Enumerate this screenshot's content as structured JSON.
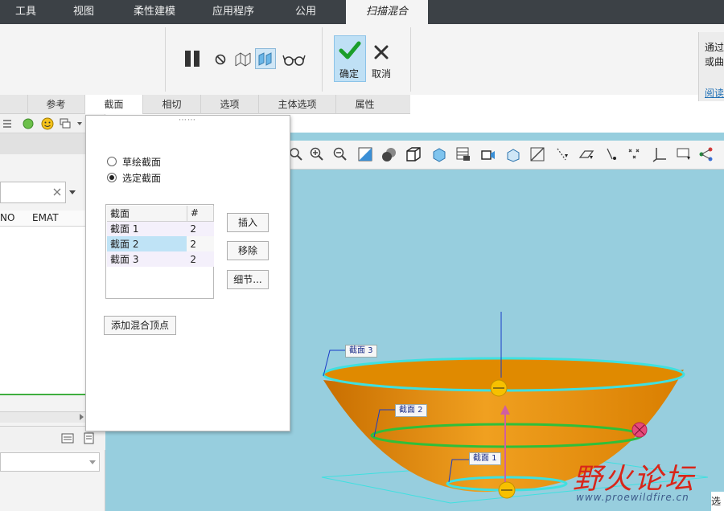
{
  "top_tabs": [
    {
      "label": "工具"
    },
    {
      "label": "视图"
    },
    {
      "label": "柔性建模"
    },
    {
      "label": "应用程序"
    },
    {
      "label": "公用"
    },
    {
      "label": "扫描混合"
    }
  ],
  "ribbon": {
    "ok_label": "确定",
    "cancel_label": "取消",
    "hint_line1": "通过",
    "hint_line2": "或曲",
    "read_link": "阅读"
  },
  "dashboard_tabs": [
    {
      "label": "参考"
    },
    {
      "label": "截面"
    },
    {
      "label": "相切"
    },
    {
      "label": "选项"
    },
    {
      "label": "主体选项"
    },
    {
      "label": "属性"
    }
  ],
  "left_panel": {
    "col1": "NO",
    "col2": "EMAT"
  },
  "section_panel": {
    "grip": "⋯⋯",
    "radio_sketch": "草绘截面",
    "radio_select": "选定截面",
    "table_header_name": "截面",
    "table_header_count": "#",
    "rows": [
      {
        "name": "截面 1",
        "count": "2"
      },
      {
        "name": "截面 2",
        "count": "2"
      },
      {
        "name": "截面 3",
        "count": "2"
      }
    ],
    "insert_label": "插入",
    "remove_label": "移除",
    "details_label": "细节...",
    "add_vertex_label": "添加混合顶点"
  },
  "viewport": {
    "labels": [
      {
        "text": "截面 3"
      },
      {
        "text": "截面 2"
      },
      {
        "text": "截面 1"
      }
    ],
    "corner_text": "选"
  },
  "watermark": {
    "cn": "野火论坛",
    "url": "www.proewildfire.cn"
  },
  "colors": {
    "top_bar": "#3c4146",
    "viewport_bg": "#97cede",
    "model_orange": "#e08a00",
    "section_cyan": "#3fe0e0",
    "section_green": "#2fbf3a",
    "accent_check": "#1a9e2a"
  }
}
